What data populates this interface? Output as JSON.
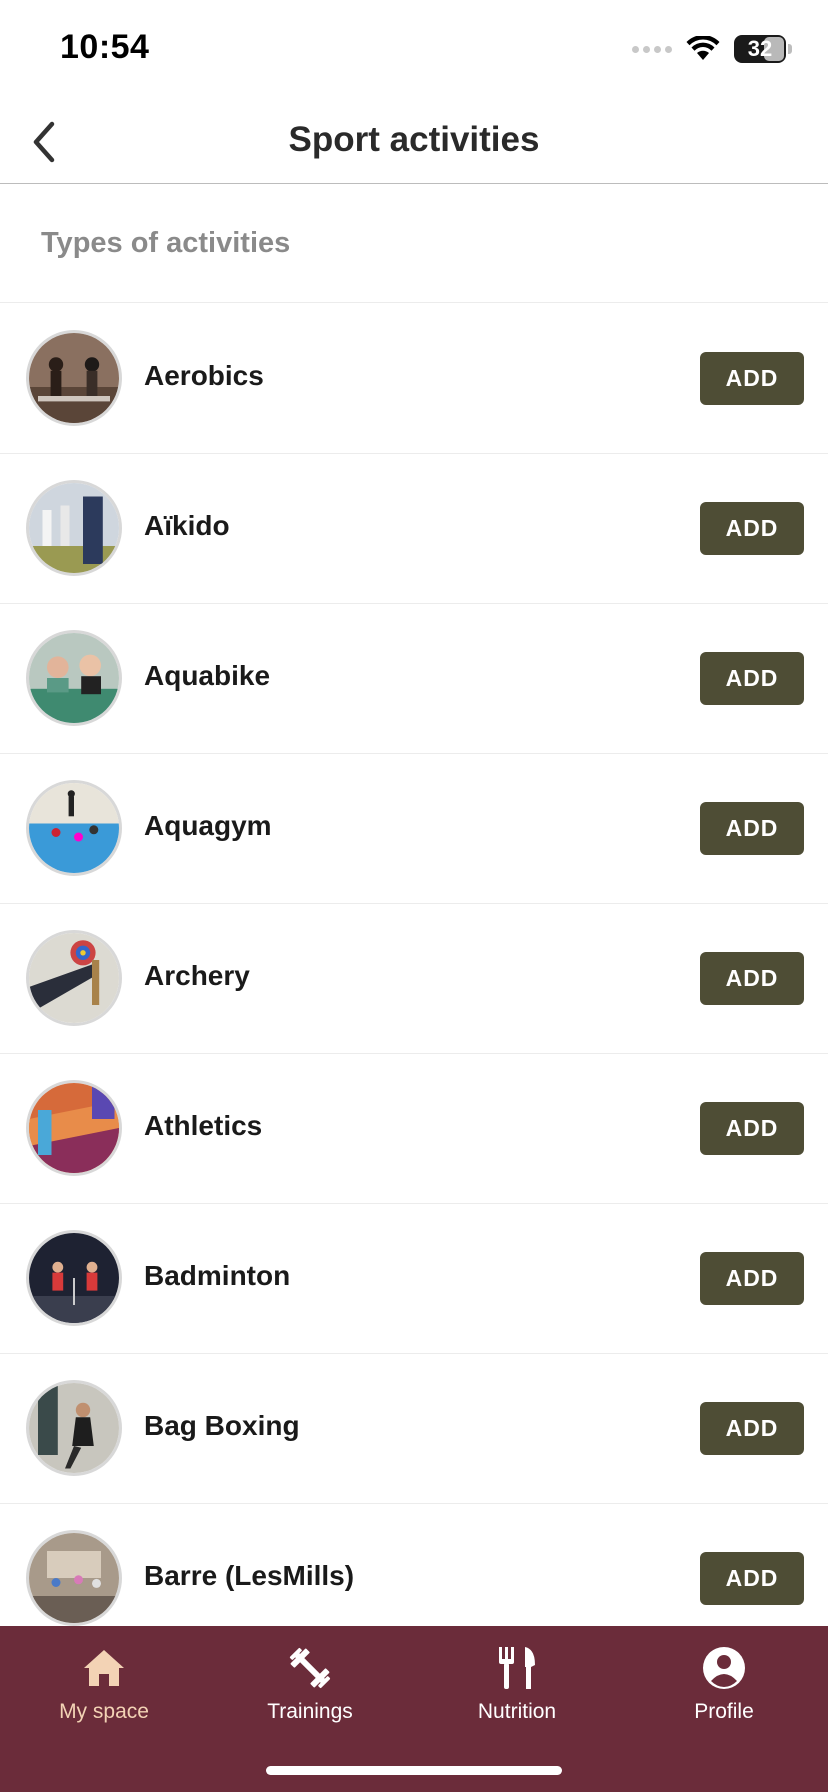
{
  "status_bar": {
    "time": "10:54",
    "battery": "32"
  },
  "header": {
    "title": "Sport activities"
  },
  "section": {
    "title": "Types of activities"
  },
  "activities": [
    {
      "name": "Aerobics",
      "add_label": "ADD"
    },
    {
      "name": "Aïkido",
      "add_label": "ADD"
    },
    {
      "name": "Aquabike",
      "add_label": "ADD"
    },
    {
      "name": "Aquagym",
      "add_label": "ADD"
    },
    {
      "name": "Archery",
      "add_label": "ADD"
    },
    {
      "name": "Athletics",
      "add_label": "ADD"
    },
    {
      "name": "Badminton",
      "add_label": "ADD"
    },
    {
      "name": "Bag Boxing",
      "add_label": "ADD"
    },
    {
      "name": "Barre (LesMills)",
      "add_label": "ADD"
    }
  ],
  "tab_bar": {
    "tabs": [
      {
        "label": "My space",
        "icon": "home-icon",
        "active": true
      },
      {
        "label": "Trainings",
        "icon": "dumbbell-icon",
        "active": false
      },
      {
        "label": "Nutrition",
        "icon": "fork-knife-icon",
        "active": false
      },
      {
        "label": "Profile",
        "icon": "profile-icon",
        "active": false
      }
    ]
  },
  "colors": {
    "accent_button": "#4e4d35",
    "tab_bar": "#6b2c3a",
    "tab_active": "#f3d3b5"
  }
}
